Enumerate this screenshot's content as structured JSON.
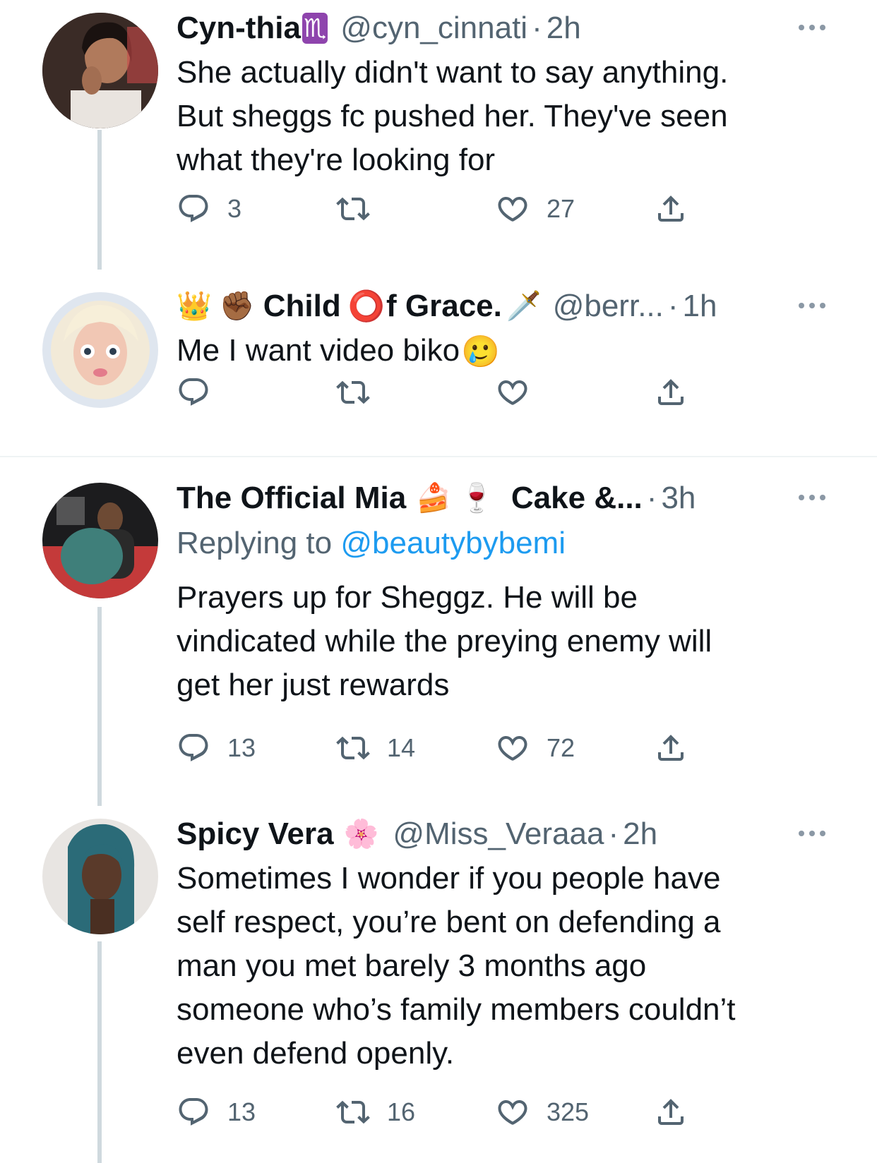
{
  "tweets": [
    {
      "name": "Cyn-thia",
      "name_emoji": "♏",
      "handle": "@cyn_cinnati",
      "dot": "·",
      "time": "2h",
      "text_lines": [
        "She actually didn't want to say anything.",
        "But sheggs fc pushed her. They've seen",
        "what they're looking for"
      ],
      "replies": "3",
      "retweets": "",
      "likes": "27"
    },
    {
      "name_prefix_emoji": "👑 ✊🏾",
      "name": "Child",
      "name_o_emoji": "⭕",
      "name_suffix": "f Grace.",
      "name_suffix_emoji": "🗡️",
      "handle": "@berr...",
      "dot": "·",
      "time": "1h",
      "text": "Me I want video biko",
      "text_emoji": "🥲",
      "replies": "",
      "retweets": "",
      "likes": ""
    },
    {
      "name": "The Official Mia",
      "name_emoji": "🍰 🍷",
      "name_suffix": "Cake &...",
      "dot": "·",
      "time": "3h",
      "replying_prefix": "Replying to",
      "replying_handle": "@beautybybemi",
      "text_lines": [
        "Prayers up for Sheggz. He will be",
        "vindicated while the preying enemy will",
        "get her just rewards"
      ],
      "replies": "13",
      "retweets": "14",
      "likes": "72"
    },
    {
      "name": "Spicy Vera",
      "name_emoji": "🌸",
      "handle": "@Miss_Veraaa",
      "dot": "·",
      "time": "2h",
      "text_lines": [
        "Sometimes I wonder if you people have",
        "self respect, you’re bent on defending a",
        "man you met barely 3 months ago",
        "someone who’s family members couldn’t",
        "even defend openly."
      ],
      "replies": "13",
      "retweets": "16",
      "likes": "325"
    }
  ],
  "icons": {
    "reply": "reply-icon",
    "retweet": "retweet-icon",
    "like": "heart-icon",
    "share": "share-icon",
    "more": "more-options-icon"
  },
  "colors": {
    "text": "#0f1419",
    "secondary": "#536471",
    "link": "#1d9bf0",
    "thread_line": "#cfd9de"
  }
}
